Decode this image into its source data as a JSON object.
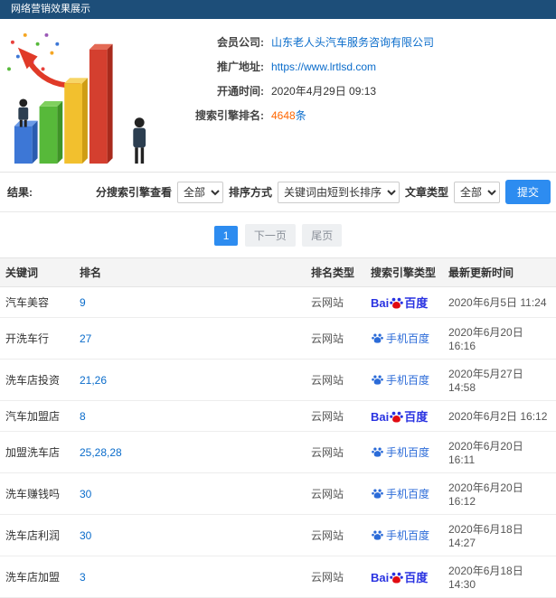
{
  "colors": {
    "topbar_bg": "#1d4e79",
    "link_blue": "#0a6ccb",
    "accent_blue": "#2d8cf0",
    "highlight_orange": "#ff6600",
    "baidu_blue": "#2932e1",
    "baidu_red": "#e10b12",
    "mobile_baidu_blue": "#2b6bd8"
  },
  "topbar": {
    "title": "网络营销效果展示"
  },
  "info": {
    "fields": [
      {
        "label": "会员公司:",
        "value": "山东老人头汽车服务咨询有限公司"
      },
      {
        "label": "推广地址:",
        "value": "https://www.lrtlsd.com"
      },
      {
        "label": "开通时间:",
        "value": "2020年4月29日 09:13"
      },
      {
        "label": "搜索引擎排名:",
        "value": "4648",
        "suffix": "条"
      }
    ]
  },
  "filters": {
    "result_label": "结果:",
    "engine_label": "分搜索引擎查看",
    "engine_value": "全部",
    "sort_label": "排序方式",
    "sort_value": "关键词由短到长排序",
    "article_label": "文章类型",
    "article_value": "全部",
    "submit_label": "提交"
  },
  "pagination": {
    "current": "1",
    "next": "下一页",
    "last": "尾页"
  },
  "engines": {
    "baidu": {
      "prefix": "Bai",
      "suffix": "百度"
    },
    "mobile_baidu": {
      "text": "手机百度"
    }
  },
  "table": {
    "headers": [
      "关键词",
      "排名",
      "排名类型",
      "搜索引擎类型",
      "最新更新时间"
    ],
    "rows": [
      {
        "keyword": "汽车美容",
        "rank": "9",
        "rank_type": "云网站",
        "engine": "baidu",
        "time": "2020年6月5日 11:24"
      },
      {
        "keyword": "开洗车行",
        "rank": "27",
        "rank_type": "云网站",
        "engine": "mobile_baidu",
        "time": "2020年6月20日 16:16"
      },
      {
        "keyword": "洗车店投资",
        "rank": "21,26",
        "rank_type": "云网站",
        "engine": "mobile_baidu",
        "time": "2020年5月27日 14:58"
      },
      {
        "keyword": "汽车加盟店",
        "rank": "8",
        "rank_type": "云网站",
        "engine": "baidu",
        "time": "2020年6月2日 16:12"
      },
      {
        "keyword": "加盟洗车店",
        "rank": "25,28,28",
        "rank_type": "云网站",
        "engine": "mobile_baidu",
        "time": "2020年6月20日 16:11"
      },
      {
        "keyword": "洗车赚钱吗",
        "rank": "30",
        "rank_type": "云网站",
        "engine": "mobile_baidu",
        "time": "2020年6月20日 16:12"
      },
      {
        "keyword": "洗车店利润",
        "rank": "30",
        "rank_type": "云网站",
        "engine": "mobile_baidu",
        "time": "2020年6月18日 14:27"
      },
      {
        "keyword": "洗车店加盟",
        "rank": "3",
        "rank_type": "云网站",
        "engine": "baidu",
        "time": "2020年6月18日 14:30"
      }
    ]
  }
}
